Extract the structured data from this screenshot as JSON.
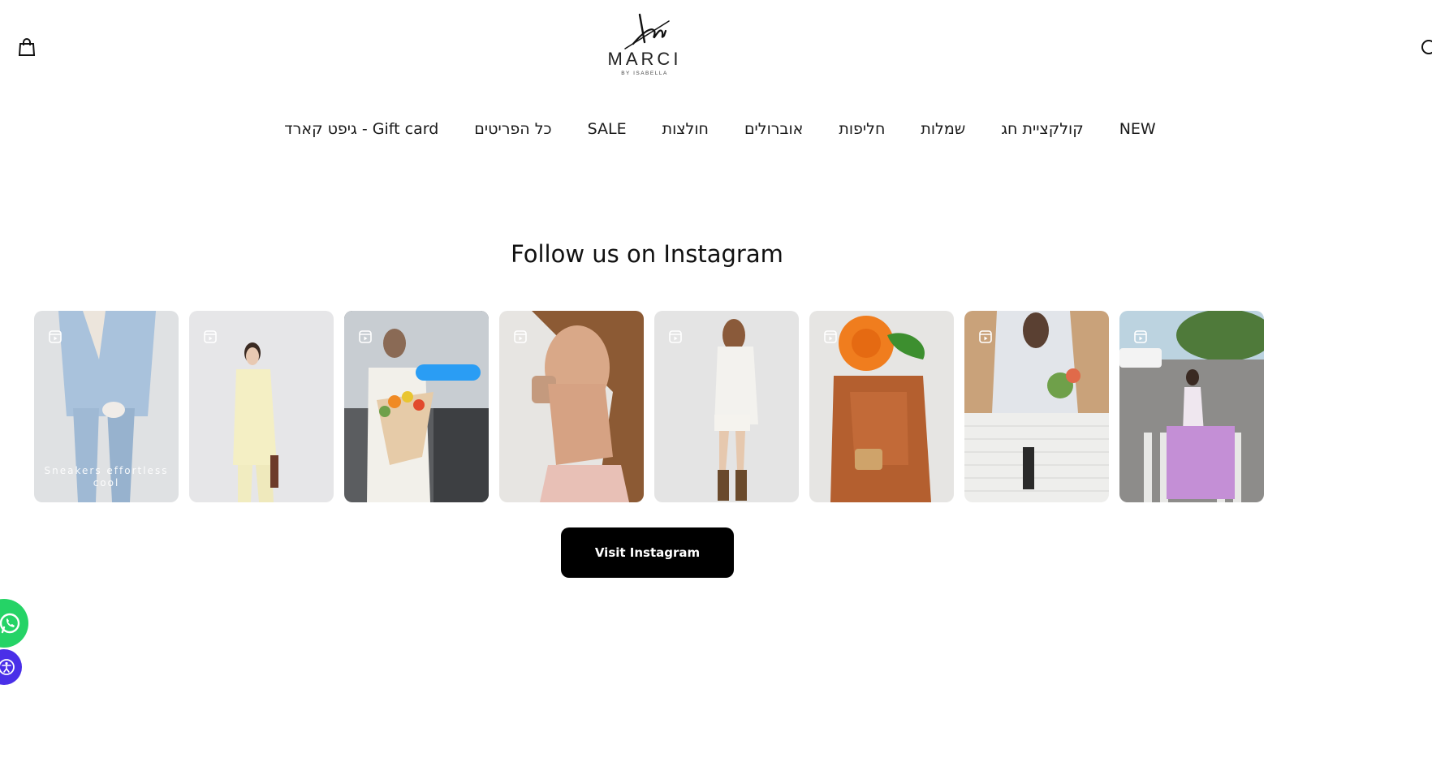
{
  "header": {
    "logo": {
      "word": "MARCI",
      "sub": "BY ISABELLA"
    },
    "cart_icon": "shopping-bag-icon",
    "search_icon": "search-icon"
  },
  "nav": {
    "items": [
      {
        "label": "NEW"
      },
      {
        "label": "קולקציית חג"
      },
      {
        "label": "שמלות"
      },
      {
        "label": "חליפות"
      },
      {
        "label": "אוברולים"
      },
      {
        "label": "חולצות"
      },
      {
        "label": "SALE"
      },
      {
        "label": "כל הפריטים"
      },
      {
        "label": "גיפט קארד - Gift card"
      }
    ]
  },
  "instagram": {
    "title": "Follow us on Instagram",
    "button": "Visit Instagram",
    "posts": [
      {
        "overlay_text": "Sneakers effortless cool"
      },
      {
        "overlay_text": ""
      },
      {
        "overlay_text": ""
      },
      {
        "overlay_text": ""
      },
      {
        "overlay_text": ""
      },
      {
        "overlay_text": ""
      },
      {
        "overlay_text": ""
      },
      {
        "overlay_text": ""
      }
    ]
  },
  "widgets": {
    "whatsapp_icon": "whatsapp-icon",
    "accessibility_icon": "accessibility-icon"
  },
  "colors": {
    "button_bg": "#000000",
    "whatsapp": "#25d366",
    "accessibility": "#4a2fe8"
  }
}
